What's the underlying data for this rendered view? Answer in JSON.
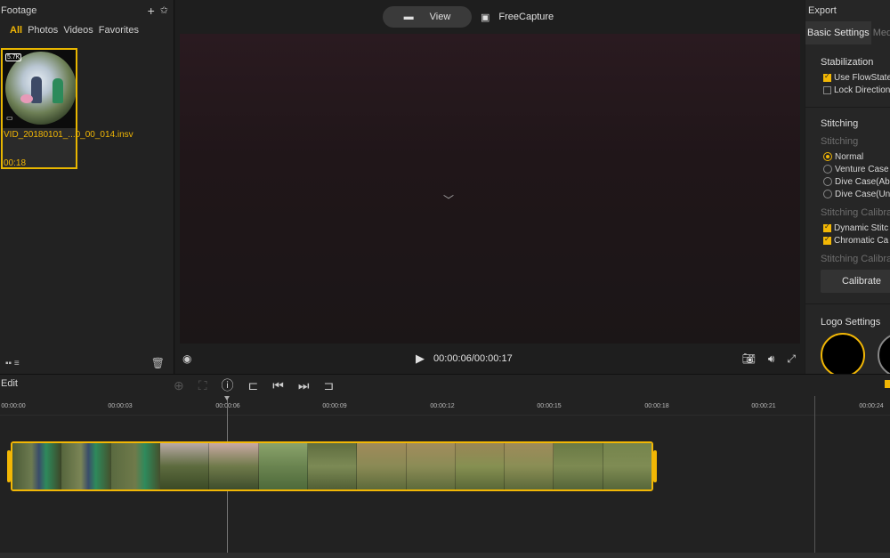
{
  "footage": {
    "title": "Footage",
    "add_icon": "plus-icon",
    "tag_icon": "star-settings-icon",
    "tabs": [
      "All",
      "Photos",
      "Videos",
      "Favorites"
    ],
    "active_tab": "All",
    "item": {
      "badge": "5.7K",
      "name": "VID_20180101_...0_00_014.insv",
      "duration": "00:18"
    },
    "footer": {
      "grid_icon": "grid-view-icon",
      "list_icon": "list-view-icon",
      "trash_icon": "trash-icon"
    }
  },
  "preview": {
    "view_label": "View",
    "freecapture_label": "FreeCapture",
    "time": "00:00:06/00:00:17"
  },
  "export": {
    "title": "Export",
    "tabs": [
      "Basic Settings",
      "Med"
    ],
    "stabilization": {
      "title": "Stabilization",
      "options": [
        {
          "label": "Use FlowState",
          "checked": true
        },
        {
          "label": "Lock Direction",
          "checked": false
        }
      ]
    },
    "stitching": {
      "title": "Stitching",
      "sub1": "Stitching",
      "radios": [
        {
          "label": "Normal",
          "checked": true
        },
        {
          "label": "Venture Case",
          "checked": false
        },
        {
          "label": "Dive Case(Ab",
          "checked": false
        },
        {
          "label": "Dive Case(Un",
          "checked": false
        }
      ],
      "sub2": "Stitching Calibra",
      "checks": [
        {
          "label": "Dynamic Stitc",
          "checked": true
        },
        {
          "label": "Chromatic Ca",
          "checked": true
        }
      ],
      "sub3": "Stitching Calibra",
      "calibrate_label": "Calibrate"
    },
    "logo": {
      "title": "Logo Settings"
    }
  },
  "edit": {
    "title": "Edit",
    "ruler": [
      "00:00:00",
      "00:00:03",
      "00:00:06",
      "00:00:09",
      "00:00:12",
      "00:00:15",
      "00:00:18",
      "00:00:21",
      "00:00:24"
    ]
  },
  "colors": {
    "accent": "#f2b705"
  }
}
